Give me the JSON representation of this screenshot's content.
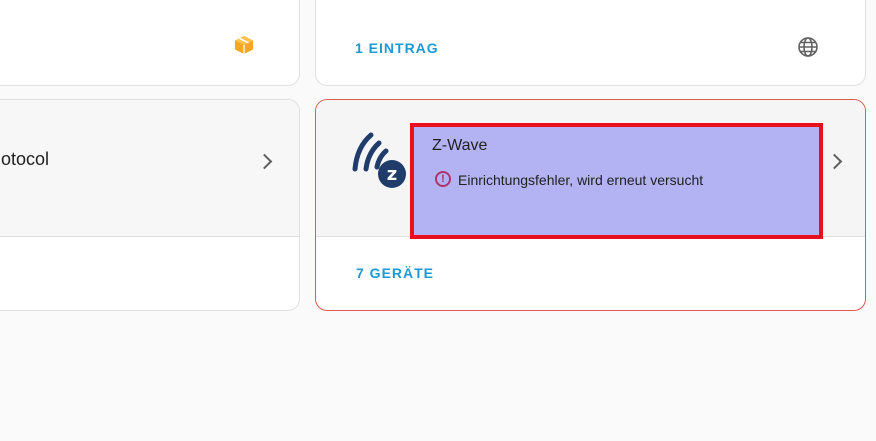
{
  "top_right_card": {
    "entries_label": "1 EINTRAG"
  },
  "protocol_card": {
    "title_fragment": "otocol"
  },
  "zwave_card": {
    "title": "Z-Wave",
    "error_message": "Einrichtungsfehler, wird erneut versucht",
    "devices_label": "7 GERÄTE"
  },
  "icons": {
    "package_icon": "package-icon",
    "globe_icon": "globe-icon",
    "chevron_right_icon": "chevron-right-icon",
    "zwave_logo": "zwave-logo",
    "error_icon": "exclamation-circle-icon"
  },
  "colors": {
    "accent_blue": "#1a9ad7",
    "error_border": "#e05a4f",
    "error_icon": "#b0326a",
    "package_orange": "#f5a623",
    "zwave_navy": "#1f3c6a",
    "highlight_fill": "#b3b3f3",
    "highlight_border": "#e8101c"
  }
}
